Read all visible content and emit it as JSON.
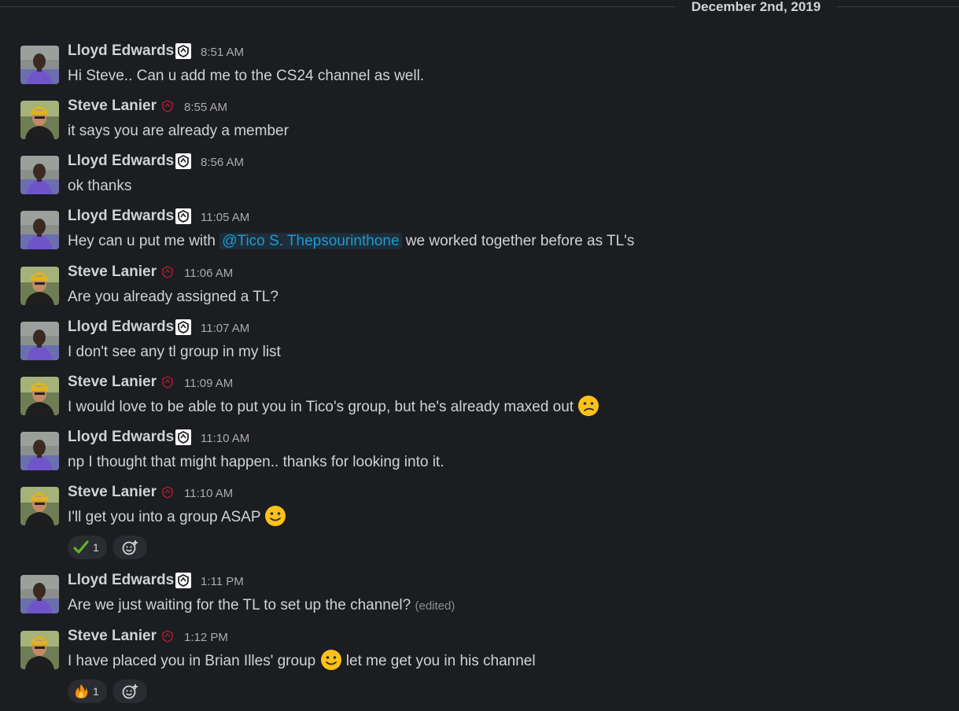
{
  "date_divider": "December 2nd, 2019",
  "users": {
    "lloyd": {
      "name": "Lloyd Edwards"
    },
    "steve": {
      "name": "Steve Lanier"
    }
  },
  "colors": {
    "background": "#1b1d21",
    "mention_text": "#1d9bd1",
    "steve_badge": "#a41d2d"
  },
  "messages": [
    {
      "author": "Lloyd Edwards",
      "time": "8:51 AM",
      "text": "Hi Steve.. Can u add me to the CS24 channel as well."
    },
    {
      "author": "Steve Lanier",
      "time": "8:55 AM",
      "text": "it says you are already a member"
    },
    {
      "author": "Lloyd Edwards",
      "time": "8:56 AM",
      "text": "ok thanks"
    },
    {
      "author": "Lloyd Edwards",
      "time": "11:05 AM",
      "text_before": "Hey can u put me with ",
      "mention": "@Tico S. Thepsourinthone",
      "text_after": " we worked together before as TL's"
    },
    {
      "author": "Steve Lanier",
      "time": "11:06 AM",
      "text": "Are you already assigned a TL?"
    },
    {
      "author": "Lloyd Edwards",
      "time": "11:07 AM",
      "text": "I don't see any tl group in my list"
    },
    {
      "author": "Steve Lanier",
      "time": "11:09 AM",
      "text": "I would love to be able to put you in Tico's group, but he's already maxed out",
      "emoji": "confused-face"
    },
    {
      "author": "Lloyd Edwards",
      "time": "11:10 AM",
      "text": "np I thought that might happen.. thanks for looking into it."
    },
    {
      "author": "Steve Lanier",
      "time": "11:10 AM",
      "text": "I'll get you into a group ASAP",
      "emoji": "slightly-smiling-face",
      "reactions": [
        {
          "emoji": "white-check-mark",
          "count": "1"
        }
      ]
    },
    {
      "author": "Lloyd Edwards",
      "time": "1:11 PM",
      "text": "Are we just waiting for the TL to set up the channel?",
      "edited": "(edited)"
    },
    {
      "author": "Steve Lanier",
      "time": "1:12 PM",
      "text_before": "I have placed you in Brian Illes' group ",
      "emoji": "slightly-smiling-face",
      "text_after": " let me get you in his channel",
      "reactions": [
        {
          "emoji": "fire",
          "count": "1"
        }
      ]
    }
  ]
}
